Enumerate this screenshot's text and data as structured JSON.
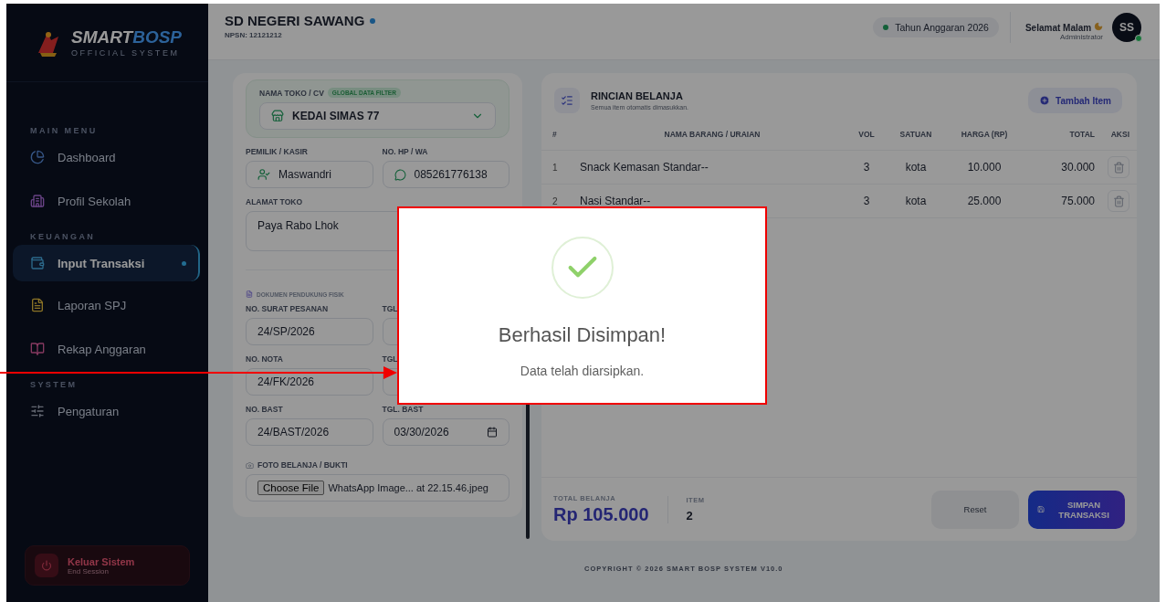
{
  "sidebar": {
    "logo": {
      "name": [
        "SMART",
        "BOSP"
      ],
      "tagline": "OFFICIAL SYSTEM"
    },
    "sections": [
      {
        "heading": "MAIN MENU",
        "items": [
          {
            "label": "Dashboard",
            "selected": false
          },
          {
            "label": "Profil Sekolah",
            "selected": false
          }
        ]
      },
      {
        "heading": "KEUANGAN",
        "items": [
          {
            "label": "Input Transaksi",
            "selected": true
          },
          {
            "label": "Laporan SPJ",
            "selected": false
          },
          {
            "label": "Rekap Anggaran",
            "selected": false
          }
        ]
      },
      {
        "heading": "SYSTEM",
        "items": [
          {
            "label": "Pengaturan",
            "selected": false
          }
        ]
      }
    ],
    "logout": {
      "label": "Keluar Sistem",
      "sublabel": "End Session"
    }
  },
  "header": {
    "school": "SD NEGERI SAWANG",
    "npsn": "NPSN: 12121212",
    "budget_year": "Tahun Anggaran 2026",
    "greeting": "Selamat Malam",
    "role": "Administrator",
    "avatar": "SS",
    "online": true
  },
  "form": {
    "store": {
      "label": "NAMA TOKO / CV",
      "badge": "GLOBAL DATA FILTER",
      "value": "KEDAI SIMAS 77"
    },
    "owner": {
      "label": "PEMILIK / KASIR",
      "value": "Maswandri"
    },
    "phone": {
      "label": "NO. HP / WA",
      "value": "085261776138"
    },
    "address": {
      "label": "ALAMAT TOKO",
      "value": "Paya Rabo Lhok"
    },
    "documents": {
      "heading": "DOKUMEN PENDUKUNG FISIK",
      "rows": [
        {
          "number": {
            "label": "NO. SURAT PESANAN",
            "value": "24/SP/2026"
          },
          "date": {
            "label": "TGL"
          }
        },
        {
          "number": {
            "label": "NO. NOTA",
            "value": "24/FK/2026"
          },
          "date": {
            "label": "TGL"
          }
        },
        {
          "number": {
            "label": "NO. BAST",
            "value": "24/BAST/2026"
          },
          "date": {
            "label": "TGL. BAST",
            "value": "03/30/2026",
            "calendar": true
          }
        }
      ]
    },
    "photo": {
      "label": "FOTO BELANJA / BUKTI",
      "button": "Choose File",
      "file": "WhatsApp Image... at 22.15.46.jpeg"
    }
  },
  "items": {
    "title": "RINCIAN BELANJA",
    "subtitle": "Semua item otomatis dimasukkan.",
    "add_button": "Tambah Item",
    "columns": [
      "#",
      "NAMA BARANG / URAIAN",
      "VOL",
      "SATUAN",
      "HARGA (RP)",
      "TOTAL",
      "AKSI"
    ],
    "rows": [
      {
        "no": "1",
        "name": "Snack Kemasan Standar--",
        "vol": "3",
        "unit": "kota",
        "price": "10.000",
        "total": "30.000"
      },
      {
        "no": "2",
        "name": "Nasi Standar--",
        "vol": "3",
        "unit": "kota",
        "price": "25.000",
        "total": "75.000"
      }
    ],
    "total_label": "TOTAL BELANJA",
    "total_value": "Rp 105.000",
    "count_label": "ITEM",
    "count_value": "2",
    "reset_button": "Reset",
    "save_button": "SIMPAN TRANSAKSI"
  },
  "copyright": "COPYRIGHT © 2026 SMART BOSP SYSTEM V10.0",
  "modal": {
    "open": true,
    "title": "Berhasil Disimpan!",
    "message": "Data telah diarsipkan."
  }
}
